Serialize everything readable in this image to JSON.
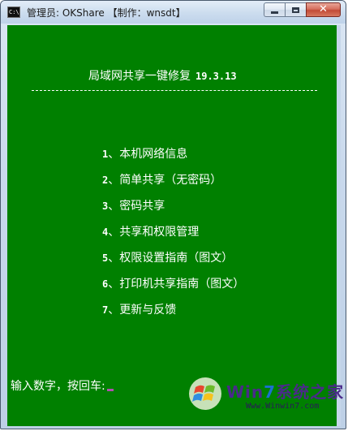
{
  "window": {
    "icon_text": "C:\\",
    "title": "管理员:  OKShare  【制作：wnsdt】",
    "close_label": "✕"
  },
  "console": {
    "heading": "局域网共享一键修复",
    "version": "19.3.13",
    "rule": "---------------------------------------------------------",
    "menu": [
      {
        "num": "1",
        "label": "、本机网络信息"
      },
      {
        "num": "2",
        "label": "、简单共享（无密码）"
      },
      {
        "num": "3",
        "label": "、密码共享"
      },
      {
        "num": "4",
        "label": "、共享和权限管理"
      },
      {
        "num": "5",
        "label": "、权限设置指南（图文）"
      },
      {
        "num": "6",
        "label": "、打印机共享指南（图文）"
      },
      {
        "num": "7",
        "label": "、更新与反馈"
      }
    ],
    "prompt": "输入数字，按回车:"
  },
  "watermark": {
    "brand_prefix": "Win",
    "brand_seven": "7",
    "brand_suffix": "系统之家",
    "url": "Www.Winwin7.com"
  },
  "colors": {
    "console_bg": "#008000",
    "console_fg": "#ffffff",
    "cursor": "#b050b0"
  }
}
